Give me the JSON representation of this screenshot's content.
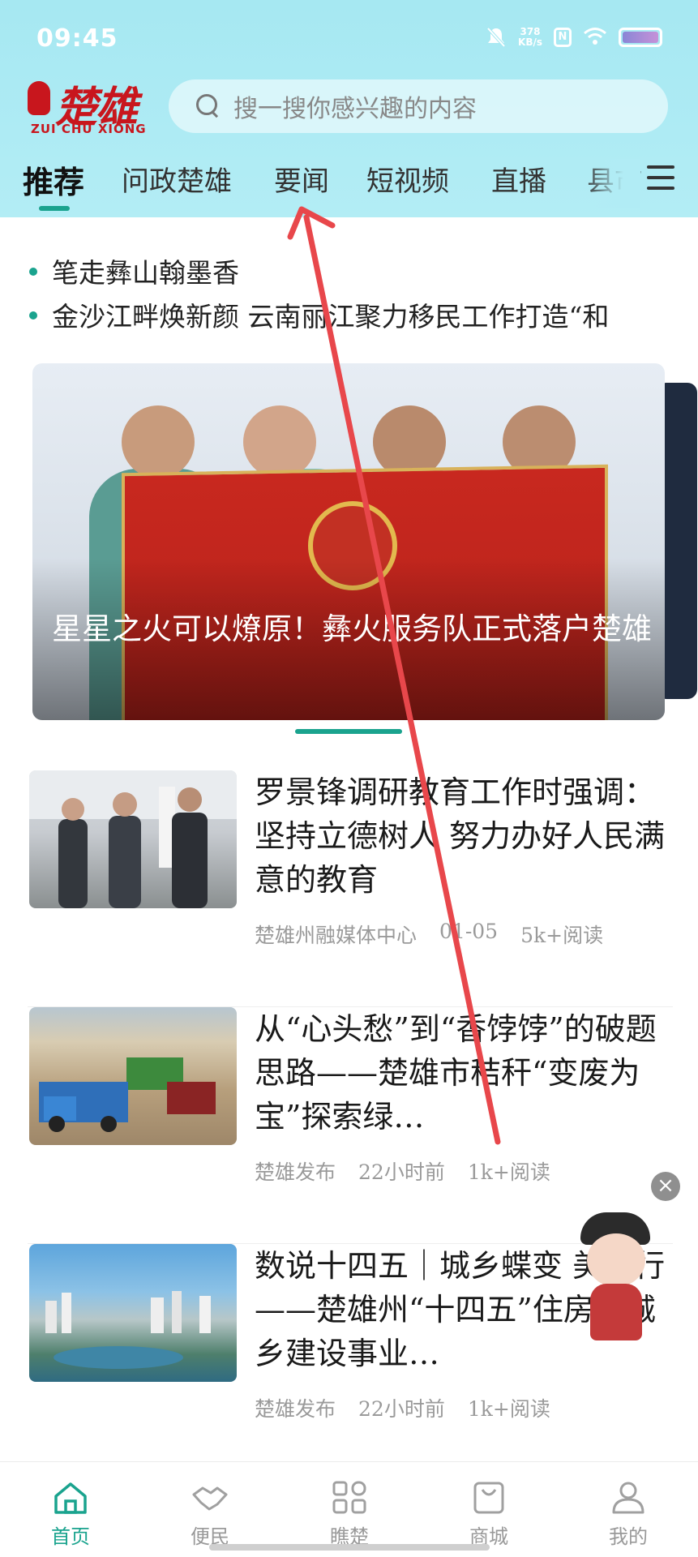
{
  "status_bar": {
    "time": "09:45",
    "net_speed_value": "378",
    "net_speed_unit": "KB/s",
    "icons": [
      "mute-icon",
      "nfc-icon",
      "wifi-icon",
      "battery-icon"
    ]
  },
  "header": {
    "logo_main": "楚雄",
    "logo_sub": "ZUI CHU XIONG",
    "search_placeholder": "搜一搜你感兴趣的内容"
  },
  "tabs": [
    {
      "label": "推荐",
      "active": true
    },
    {
      "label": "问政楚雄",
      "active": false
    },
    {
      "label": "要闻",
      "active": false
    },
    {
      "label": "短视频",
      "active": false
    },
    {
      "label": "直播",
      "active": false
    },
    {
      "label": "县市",
      "active": false
    }
  ],
  "ticker": [
    "笔走彝山翰墨香",
    "金沙江畔焕新颜 云南丽江聚力移民工作打造“和"
  ],
  "banner": {
    "caption": "星星之火可以燎原！彝火服务队正式落户楚雄"
  },
  "news": [
    {
      "title": "罗景锋调研教育工作时强调：坚持立德树人 努力办好人民满意的教育",
      "source": "楚雄州融媒体中心",
      "date": "01-05",
      "reads": "5k+阅读"
    },
    {
      "title": "从“心头愁”到“香饽饽”的破题思路——楚雄市秸秆“变废为宝”探索绿…",
      "source": "楚雄发布",
      "date": "22小时前",
      "reads": "1k+阅读"
    },
    {
      "title": "数说十四五｜城乡蝶变 美而行——楚雄州“十四五”住房和城乡建设事业…",
      "source": "楚雄发布",
      "date": "22小时前",
      "reads": "1k+阅读"
    }
  ],
  "bottom_nav": [
    {
      "label": "首页",
      "icon": "home-icon",
      "active": true
    },
    {
      "label": "便民",
      "icon": "handshake-icon",
      "active": false
    },
    {
      "label": "瞧楚",
      "icon": "grid-icon",
      "active": false
    },
    {
      "label": "商城",
      "icon": "shopping-bag-icon",
      "active": false
    },
    {
      "label": "我的",
      "icon": "user-icon",
      "active": false
    }
  ],
  "colors": {
    "accent": "#1aa38e",
    "header_bg": "#a6e8f2",
    "brand_red": "#c8161d",
    "annotation_arrow": "#e8474b"
  }
}
